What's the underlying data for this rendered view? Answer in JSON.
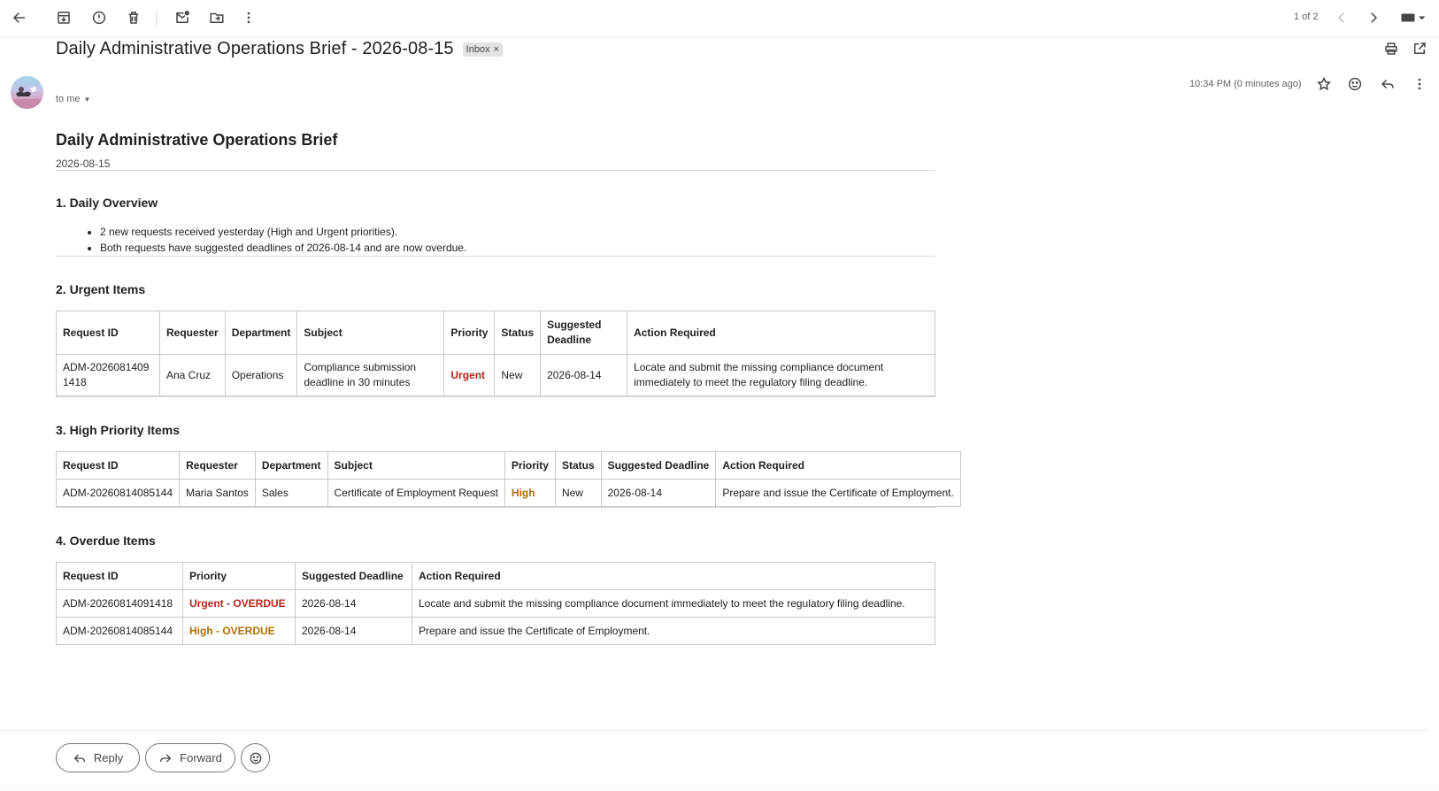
{
  "toolbar": {
    "pager": "1 of 2"
  },
  "email": {
    "subject": "Daily Administrative Operations Brief - 2026-08-15",
    "label": "Inbox",
    "label_remove": "×",
    "recipient": "to me",
    "timestamp": "10:34 PM (0 minutes ago)"
  },
  "body": {
    "title": "Daily Administrative Operations Brief",
    "date": "2026-08-15",
    "overview": {
      "heading": "1. Daily Overview",
      "bullets": [
        "2 new requests received yesterday (High and Urgent priorities).",
        "Both requests have suggested deadlines of 2026-08-14 and are now overdue."
      ]
    },
    "urgent": {
      "heading": "2. Urgent Items",
      "columns": [
        "Request ID",
        "Requester",
        "Department",
        "Subject",
        "Priority",
        "Status",
        "Suggested Deadline",
        "Action Required"
      ],
      "rows": [
        [
          "ADM-20260814091418",
          "Ana Cruz",
          "Operations",
          "Compliance submission deadline in 30 minutes",
          "Urgent",
          "New",
          "2026-08-14",
          "Locate and submit the missing compliance document immediately to meet the regulatory filing deadline."
        ]
      ]
    },
    "high": {
      "heading": "3. High Priority Items",
      "columns": [
        "Request ID",
        "Requester",
        "Department",
        "Subject",
        "Priority",
        "Status",
        "Suggested Deadline",
        "Action Required"
      ],
      "rows": [
        [
          "ADM-20260814085144",
          "Maria Santos",
          "Sales",
          "Certificate of Employment Request",
          "High",
          "New",
          "2026-08-14",
          "Prepare and issue the Certificate of Employment."
        ]
      ]
    },
    "overdue": {
      "heading": "4. Overdue Items",
      "columns": [
        "Request ID",
        "Priority",
        "Suggested Deadline",
        "Action Required"
      ],
      "rows": [
        [
          "ADM-20260814091418",
          "Urgent - OVERDUE",
          "2026-08-14",
          "Locate and submit the missing compliance document immediately to meet the regulatory filing deadline."
        ],
        [
          "ADM-20260814085144",
          "High - OVERDUE",
          "2026-08-14",
          "Prepare and issue the Certificate of Employment."
        ]
      ]
    }
  },
  "actions": {
    "reply": "Reply",
    "forward": "Forward"
  },
  "colors": {
    "urgent": "#b3261e",
    "high": "#b06d00"
  }
}
